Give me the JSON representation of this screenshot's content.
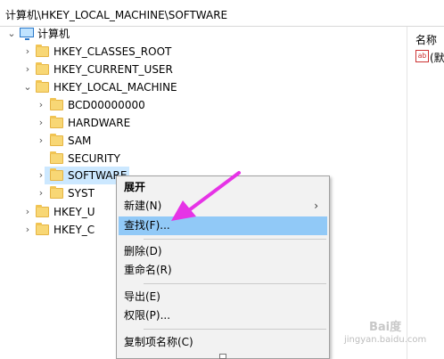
{
  "address_bar": {
    "path": "计算机\\HKEY_LOCAL_MACHINE\\SOFTWARE"
  },
  "tree": {
    "root": {
      "label": "计算机",
      "icon": "computer-icon"
    },
    "items": [
      {
        "label": "HKEY_CLASSES_ROOT"
      },
      {
        "label": "HKEY_CURRENT_USER"
      },
      {
        "label": "HKEY_LOCAL_MACHINE"
      },
      {
        "label": "BCD00000000"
      },
      {
        "label": "HARDWARE"
      },
      {
        "label": "SAM"
      },
      {
        "label": "SECURITY"
      },
      {
        "label": "SOFTWARE"
      },
      {
        "label": "SYST"
      },
      {
        "label": "HKEY_U"
      },
      {
        "label": "HKEY_C"
      }
    ]
  },
  "values_pane": {
    "column_name": "名称",
    "value_icon": "ab",
    "value_name": "(默"
  },
  "context_menu": {
    "items": [
      {
        "label": "展开"
      },
      {
        "label": "新建(N)",
        "submenu": "›"
      },
      {
        "label": "查找(F)..."
      },
      {
        "label": "删除(D)"
      },
      {
        "label": "重命名(R)"
      },
      {
        "label": "导出(E)"
      },
      {
        "label": "权限(P)..."
      },
      {
        "label": "复制项名称(C)"
      }
    ]
  },
  "watermark": {
    "brand": "Bai度",
    "site": "jingyan.baidu.com"
  },
  "colors": {
    "selection": "#cce8ff",
    "menu_highlight": "#91c9f7",
    "arrow": "#e633e6",
    "folder": "#f8d775"
  }
}
